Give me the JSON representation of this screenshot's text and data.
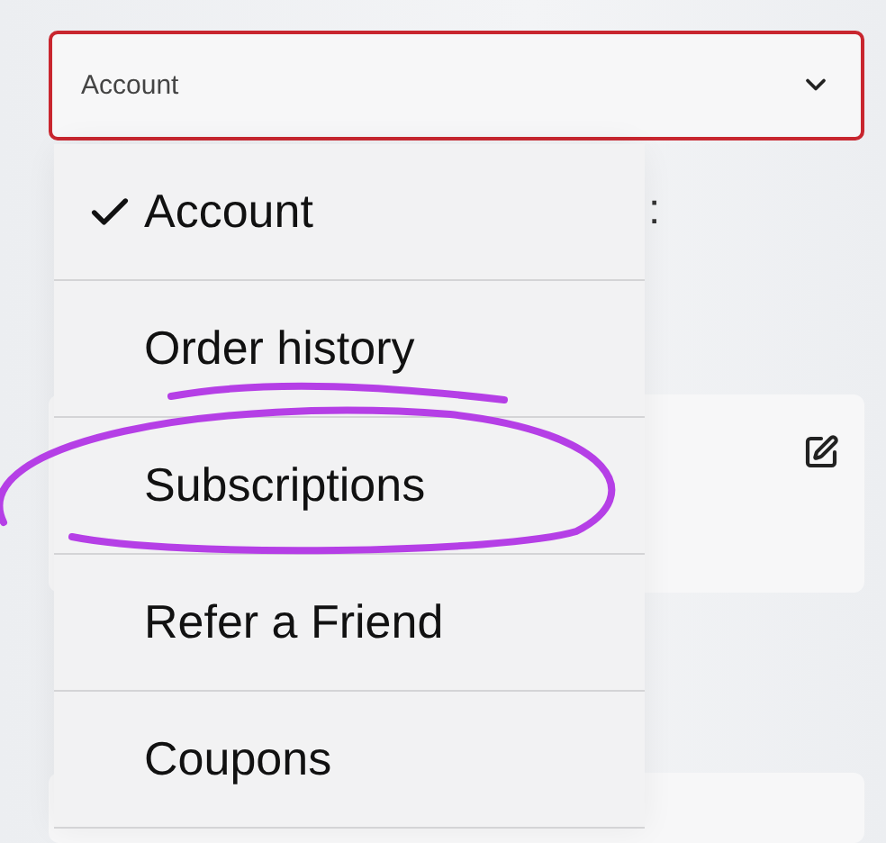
{
  "select": {
    "value": "Account",
    "invalid": true
  },
  "background": {
    "heading_fragment": ":"
  },
  "menu": [
    {
      "label": "Account",
      "selected": true
    },
    {
      "label": "Order history",
      "selected": false
    },
    {
      "label": "Subscriptions",
      "selected": false
    },
    {
      "label": "Refer a Friend",
      "selected": false
    },
    {
      "label": "Coupons",
      "selected": false
    }
  ]
}
